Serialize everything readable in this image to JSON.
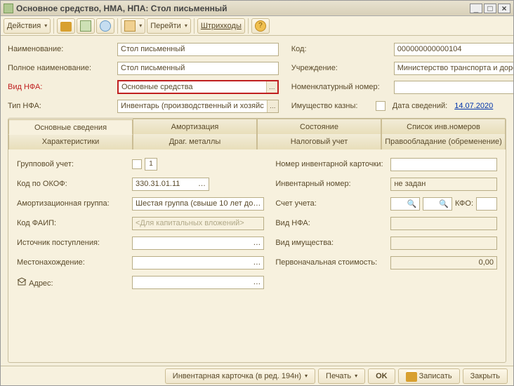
{
  "window": {
    "title": "Основное средство, НМА, НПА: Стол письменный"
  },
  "toolbar": {
    "actions": "Действия",
    "goto": "Перейти",
    "barcodes": "Штрихкоды"
  },
  "header": {
    "name_label": "Наименование:",
    "name_value": "Стол письменный",
    "code_label": "Код:",
    "code_value": "000000000000104",
    "fullname_label": "Полное наименование:",
    "fullname_value": "Стол письменный",
    "institution_label": "Учреждение:",
    "institution_value": "Министерство транспорта и доро",
    "nfa_kind_label": "Вид НФА:",
    "nfa_kind_value": "Основные средства",
    "nomnum_label": "Номенклатурный номер:",
    "nfa_type_label": "Тип НФА:",
    "nfa_type_value": "Инвентарь (производственный и хозяйс",
    "treasury_label": "Имущество казны:",
    "date_label": "Дата сведений:",
    "date_value": "14.07.2020"
  },
  "tabs": {
    "r1": [
      "Основные сведения",
      "Амортизация",
      "Состояние",
      "Список инв.номеров"
    ],
    "r2": [
      "Характеристики",
      "Драг. металлы",
      "Налоговый учет",
      "Правообладание (обременение)"
    ]
  },
  "main": {
    "group_label": "Групповой учет:",
    "group_box": "1",
    "okof_label": "Код по ОКОФ:",
    "okof_value": "330.31.01.11",
    "amort_label": "Амортизационная группа:",
    "amort_value": "Шестая группа (свыше 10 лет до",
    "faip_label": "Код ФАИП:",
    "faip_placeholder": "<Для капитальных вложений>",
    "src_label": "Источник поступления:",
    "loc_label": "Местонахождение:",
    "addr_label": "Адрес:",
    "card_label": "Номер инвентарной карточки:",
    "invnum_label": "Инвентарный номер:",
    "invnum_value": "не задан",
    "account_label": "Счет учета:",
    "kfo_label": "КФО:",
    "nfa_kind2_label": "Вид НФА:",
    "prop_kind_label": "Вид имущества:",
    "initcost_label": "Первоначальная стоимость:",
    "initcost_value": "0,00"
  },
  "footer": {
    "card": "Инвентарная карточка (в ред. 194н)",
    "print": "Печать",
    "ok": "OK",
    "save": "Записать",
    "close": "Закрыть"
  }
}
